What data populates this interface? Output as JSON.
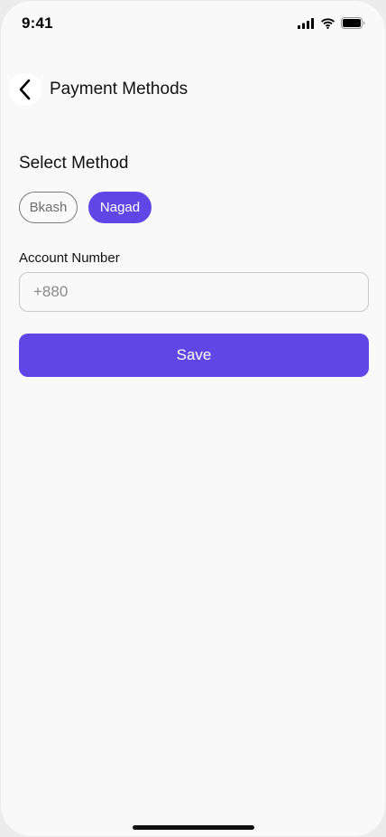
{
  "status_bar": {
    "time": "9:41",
    "icons": [
      "cellular-signal-icon",
      "wifi-icon",
      "battery-icon"
    ]
  },
  "header": {
    "back_icon": "chevron-left-icon",
    "title": "Payment Methods"
  },
  "method_section": {
    "title": "Select Method",
    "options": [
      {
        "label": "Bkash",
        "selected": false
      },
      {
        "label": "Nagad",
        "selected": true
      }
    ]
  },
  "account_field": {
    "label": "Account Number",
    "value": "",
    "placeholder": "+880"
  },
  "save_button": {
    "label": "Save"
  },
  "colors": {
    "accent": "#6046e6",
    "background": "#f9f9f9"
  }
}
